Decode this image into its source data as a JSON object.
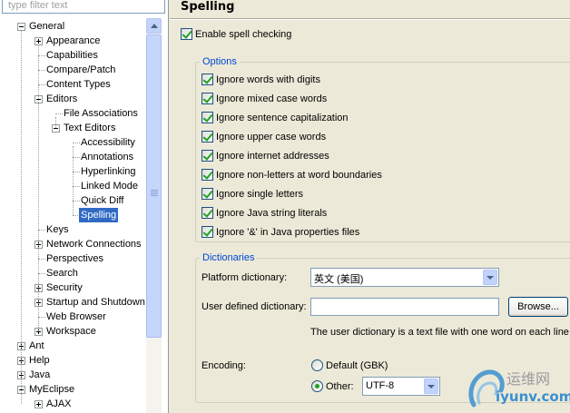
{
  "filter": {
    "placeholder": "type filter text"
  },
  "tree": [
    {
      "label": "General",
      "level": 0,
      "expander": "minus"
    },
    {
      "label": "Appearance",
      "level": 1,
      "expander": "plus"
    },
    {
      "label": "Capabilities",
      "level": 1,
      "expander": null
    },
    {
      "label": "Compare/Patch",
      "level": 1,
      "expander": null
    },
    {
      "label": "Content Types",
      "level": 1,
      "expander": null
    },
    {
      "label": "Editors",
      "level": 1,
      "expander": "minus"
    },
    {
      "label": "File Associations",
      "level": 2,
      "expander": null
    },
    {
      "label": "Text Editors",
      "level": 2,
      "expander": "minus"
    },
    {
      "label": "Accessibility",
      "level": 3,
      "expander": null
    },
    {
      "label": "Annotations",
      "level": 3,
      "expander": null
    },
    {
      "label": "Hyperlinking",
      "level": 3,
      "expander": null
    },
    {
      "label": "Linked Mode",
      "level": 3,
      "expander": null
    },
    {
      "label": "Quick Diff",
      "level": 3,
      "expander": null
    },
    {
      "label": "Spelling",
      "level": 3,
      "expander": null,
      "selected": true
    },
    {
      "label": "Keys",
      "level": 1,
      "expander": null
    },
    {
      "label": "Network Connections",
      "level": 1,
      "expander": "plus"
    },
    {
      "label": "Perspectives",
      "level": 1,
      "expander": null
    },
    {
      "label": "Search",
      "level": 1,
      "expander": null
    },
    {
      "label": "Security",
      "level": 1,
      "expander": "plus"
    },
    {
      "label": "Startup and Shutdown",
      "level": 1,
      "expander": "plus"
    },
    {
      "label": "Web Browser",
      "level": 1,
      "expander": null
    },
    {
      "label": "Workspace",
      "level": 1,
      "expander": "plus"
    },
    {
      "label": "Ant",
      "level": 0,
      "expander": "plus"
    },
    {
      "label": "Help",
      "level": 0,
      "expander": "plus"
    },
    {
      "label": "Java",
      "level": 0,
      "expander": "plus"
    },
    {
      "label": "MyEclipse",
      "level": 0,
      "expander": "minus"
    },
    {
      "label": "AJAX",
      "level": 1,
      "expander": "plus"
    }
  ],
  "page": {
    "title": "Spelling",
    "enable_spell_checking": {
      "label": "Enable spell checking",
      "checked": true
    }
  },
  "options": {
    "title": "Options",
    "items": [
      {
        "label": "Ignore words with digits",
        "checked": true
      },
      {
        "label": "Ignore mixed case words",
        "checked": true
      },
      {
        "label": "Ignore sentence capitalization",
        "checked": true
      },
      {
        "label": "Ignore upper case words",
        "checked": true
      },
      {
        "label": "Ignore internet addresses",
        "checked": true
      },
      {
        "label": "Ignore non-letters at word boundaries",
        "checked": true
      },
      {
        "label": "Ignore single letters",
        "checked": true
      },
      {
        "label": "Ignore Java string literals",
        "checked": true
      },
      {
        "label": "Ignore '&' in Java properties files",
        "checked": true
      }
    ]
  },
  "dictionaries": {
    "title": "Dictionaries",
    "platform_label": "Platform dictionary:",
    "platform_value": "英文 (美国)",
    "user_label": "User defined dictionary:",
    "user_value": "",
    "browse_label": "Browse...",
    "note": "The user dictionary is a text file with one word on each line",
    "encoding_label": "Encoding:",
    "default_label": "Default (GBK)",
    "default_checked": false,
    "other_label": "Other:",
    "other_checked": true,
    "other_value": "UTF-8"
  },
  "watermark": {
    "cn": "运维网",
    "en": "iyunv.com"
  },
  "colors": {
    "selection": "#316ac5",
    "group_title": "#0046d5",
    "background": "#ece9d8"
  }
}
